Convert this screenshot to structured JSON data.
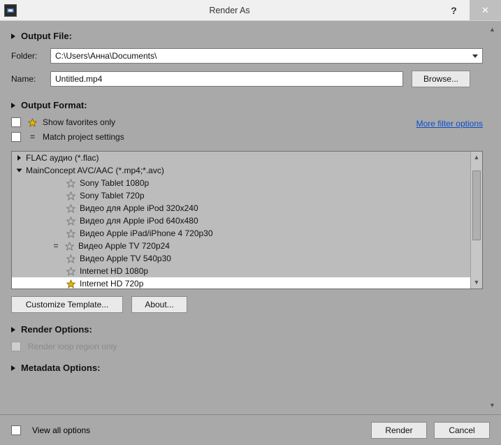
{
  "window": {
    "title": "Render As",
    "help_glyph": "?",
    "close_glyph": "✕"
  },
  "output_file": {
    "heading": "Output File:",
    "folder_label": "Folder:",
    "folder_value": "C:\\Users\\Анна\\Documents\\",
    "name_label": "Name:",
    "name_value": "Untitled.mp4",
    "browse_btn": "Browse..."
  },
  "output_format": {
    "heading": "Output Format:",
    "show_fav": "Show favorites only",
    "match_proj": "Match project settings",
    "more_filter": "More filter options",
    "tree": {
      "flac": "FLAC аудио (*.flac)",
      "avc": "MainConcept AVC/AAC (*.mp4;*.avc)",
      "items": [
        "Sony Tablet 1080p",
        "Sony Tablet 720p",
        "Видео для Apple iPod 320x240",
        "Видео для Apple iPod 640x480",
        "Видео Apple iPad/iPhone 4 720p30",
        "Видео Apple TV 720p24",
        "Видео Apple TV 540p30",
        "Internet HD 1080p",
        "Internet HD 720p"
      ]
    },
    "customize_btn": "Customize Template...",
    "about_btn": "About..."
  },
  "render_options": {
    "heading": "Render Options:",
    "loop_region": "Render loop region only"
  },
  "metadata": {
    "heading": "Metadata Options:"
  },
  "footer": {
    "view_all": "View all options",
    "render_btn": "Render",
    "cancel_btn": "Cancel"
  }
}
